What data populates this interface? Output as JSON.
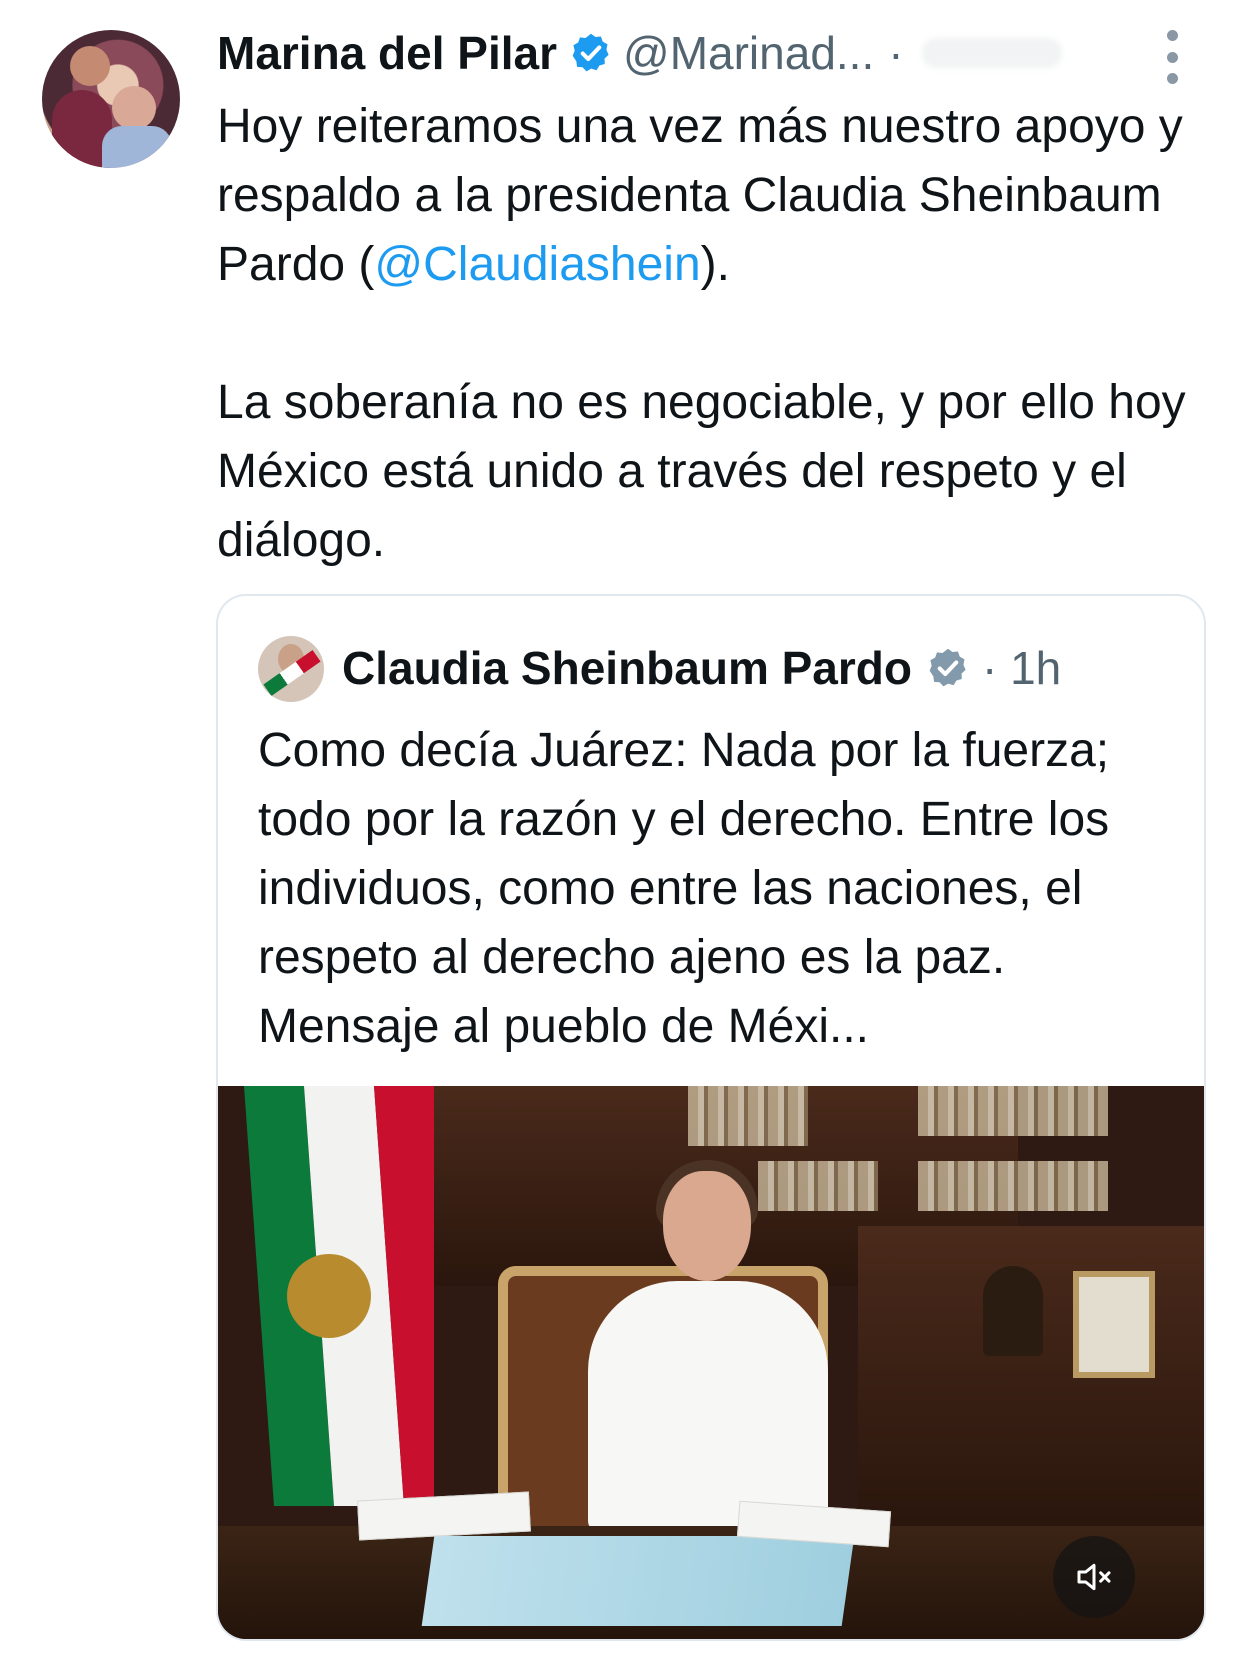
{
  "author": {
    "name": "Marina del Pilar",
    "handle": "@Marinad...",
    "separator": "·"
  },
  "tweet": {
    "line1_prefix": "Hoy reiteramos una vez más nuestro apoyo y respaldo a la presidenta Claudia Sheinbaum Pardo (",
    "mention": "@Claudiashein",
    "line1_suffix": ").",
    "paragraph2": "La soberanía no es negociable, y por ello hoy México está unido a través del respeto y el diálogo."
  },
  "quoted": {
    "name": "Claudia Sheinbaum Pardo",
    "time": "· 1h",
    "text": "Como decía Juárez: Nada por la fuerza; todo por la razón y el derecho. Entre los individuos, como entre las naciones, el respeto al derecho ajeno es la paz. Mensaje al pueblo de Méxi..."
  },
  "icons": {
    "verified_author": "verified-badge-blue",
    "verified_quoted": "verified-badge-gray",
    "more": "more-vertical-icon",
    "mute": "volume-muted-icon"
  },
  "colors": {
    "text": "#0f1419",
    "secondary": "#536471",
    "link": "#1d9bf0",
    "verified_blue": "#1d9bf0",
    "verified_gray": "#829aab",
    "border": "#e1e8ed"
  }
}
